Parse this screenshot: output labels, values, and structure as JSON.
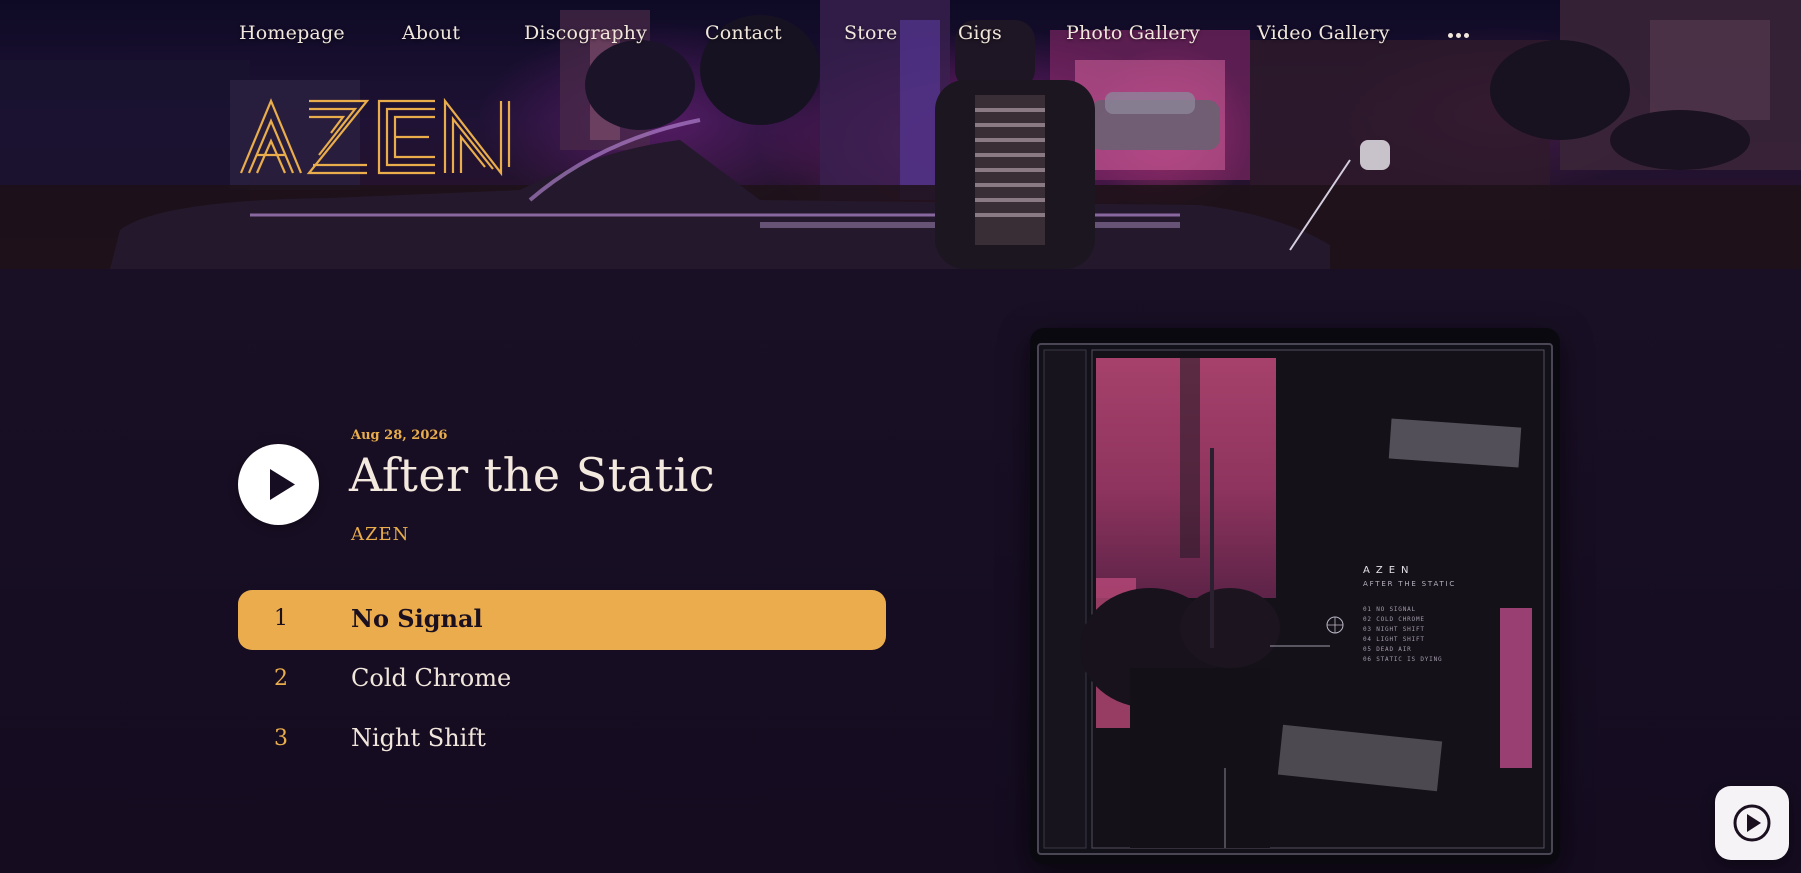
{
  "nav": {
    "items": [
      {
        "label": "Homepage"
      },
      {
        "label": "About"
      },
      {
        "label": "Discography"
      },
      {
        "label": "Contact"
      },
      {
        "label": "Store"
      },
      {
        "label": "Gigs"
      },
      {
        "label": "Photo Gallery"
      },
      {
        "label": "Video Gallery"
      }
    ],
    "more_icon": "ellipsis-icon"
  },
  "logo": {
    "text": "AZEN",
    "color": "#e9ad4b"
  },
  "release": {
    "date": "Aug 28, 2026",
    "title": "After the Static",
    "artist": "AZEN",
    "play_icon": "play-icon"
  },
  "tracks": [
    {
      "number": "1",
      "title": "No Signal",
      "active": true
    },
    {
      "number": "2",
      "title": "Cold Chrome",
      "active": false
    },
    {
      "number": "3",
      "title": "Night Shift",
      "active": false
    }
  ],
  "cover": {
    "artist": "AZEN",
    "subtitle": "AFTER THE STATIC",
    "tracks": [
      "01 NO SIGNAL",
      "02 COLD CHROME",
      "03 NIGHT SHIFT",
      "04 LIGHT SHIFT",
      "05 DEAD AIR",
      "06 STATIC IS DYING"
    ]
  },
  "floating_player": {
    "icon": "play-circle-icon"
  },
  "colors": {
    "accent": "#e9ad4b",
    "background": "#160d22",
    "text": "#f3e9de"
  }
}
